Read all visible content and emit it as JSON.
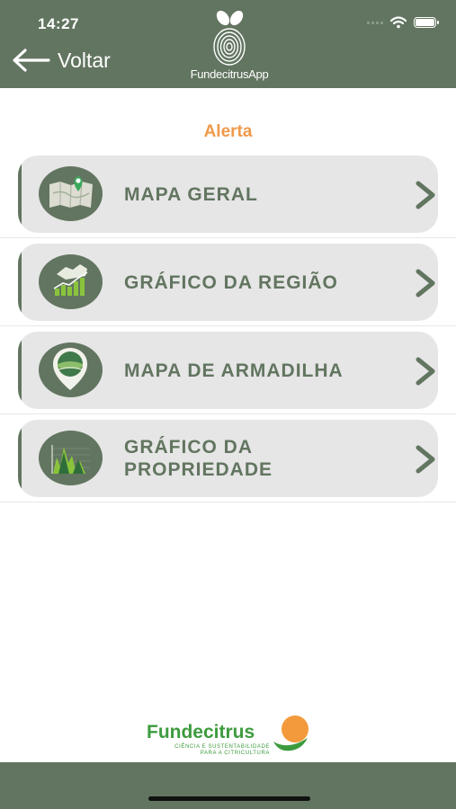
{
  "status_bar": {
    "time": "14:27"
  },
  "header": {
    "back_label": "Voltar",
    "app_name": "FundecitrusApp"
  },
  "section_title": "Alerta",
  "menu_items": [
    {
      "label": "MAPA GERAL",
      "icon": "map-pin-icon"
    },
    {
      "label": "GRÁFICO DA REGIÃO",
      "icon": "region-chart-icon"
    },
    {
      "label": "MAPA DE ARMADILHA",
      "icon": "trap-map-icon"
    },
    {
      "label": "GRÁFICO DA PROPRIEDADE",
      "icon": "property-chart-icon"
    }
  ],
  "footer": {
    "brand": "Fundecitrus",
    "tagline_line1": "CIÊNCIA E SUSTENTABILIDADE",
    "tagline_line2": "PARA A CITRICULTURA"
  },
  "colors": {
    "primary_green": "#627560",
    "accent_orange": "#f09a4a",
    "card_gray": "#e6e6e6",
    "brand_green": "#3d9b3e"
  }
}
